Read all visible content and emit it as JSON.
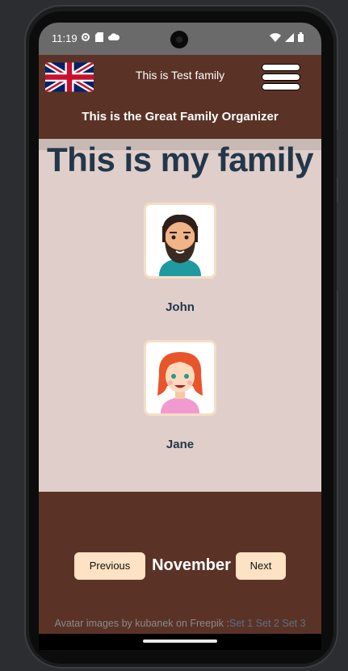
{
  "status_bar": {
    "time": "11:19",
    "left_icons": [
      "settings-icon",
      "sd-card-icon",
      "cloud-icon"
    ],
    "right_icons": [
      "wifi-icon",
      "signal-icon",
      "battery-icon"
    ]
  },
  "header": {
    "flag_icon": "uk-flag-icon",
    "family_name": "This is Test family",
    "menu_icon": "hamburger-menu-icon",
    "subtitle": "This is the Great Family Organizer"
  },
  "main": {
    "title": "This is my family",
    "members": [
      {
        "name": "John",
        "avatar": "bearded-man-avatar"
      },
      {
        "name": "Jane",
        "avatar": "red-haired-girl-avatar"
      }
    ]
  },
  "month_nav": {
    "previous_label": "Previous",
    "month": "November",
    "next_label": "Next"
  },
  "footer": {
    "credits_text": "Avatar images by kubanek on Freepik :",
    "sets": [
      "Set 1",
      "Set 2",
      "Set 3"
    ]
  },
  "colors": {
    "header_bg": "#5a3326",
    "content_bg": "#e0ceca",
    "title_color": "#22384a",
    "button_bg": "#fde2c4",
    "link_color": "#5d6f86"
  }
}
